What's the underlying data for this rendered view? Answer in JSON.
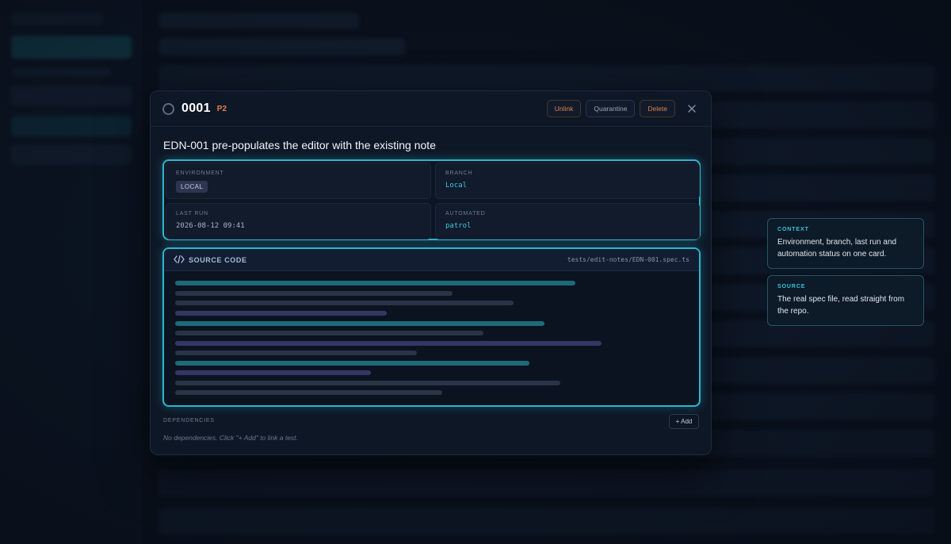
{
  "ticket": {
    "id": "0001",
    "priority": "P2",
    "title": "EDN-001 pre-populates the editor with the existing note"
  },
  "actions": {
    "unlink": "Unlink",
    "quarantine": "Quarantine",
    "delete": "Delete"
  },
  "info": {
    "environment": {
      "label": "ENVIRONMENT",
      "value": "LOCAL"
    },
    "branch": {
      "label": "BRANCH",
      "value": "Local"
    },
    "last_run": {
      "label": "LAST RUN",
      "value": "2026-08-12 09:41"
    },
    "automated": {
      "label": "AUTOMATED",
      "value": "patrol"
    }
  },
  "source": {
    "title": "SOURCE CODE",
    "path": "tests/edit-notes/EDN-001.spec.ts"
  },
  "dependencies": {
    "label": "DEPENDENCIES",
    "add_label": "+ Add",
    "empty_text": "No dependencies. Click \"+ Add\" to link a test."
  },
  "callouts": [
    {
      "label": "CONTEXT",
      "text": "Environment, branch, last run and automation status on one card."
    },
    {
      "label": "SOURCE",
      "text": "The real spec file, read straight from the repo."
    }
  ],
  "colors": {
    "accent": "#2bb6cf",
    "priority": "#e0804a",
    "background": "#0a111d"
  }
}
